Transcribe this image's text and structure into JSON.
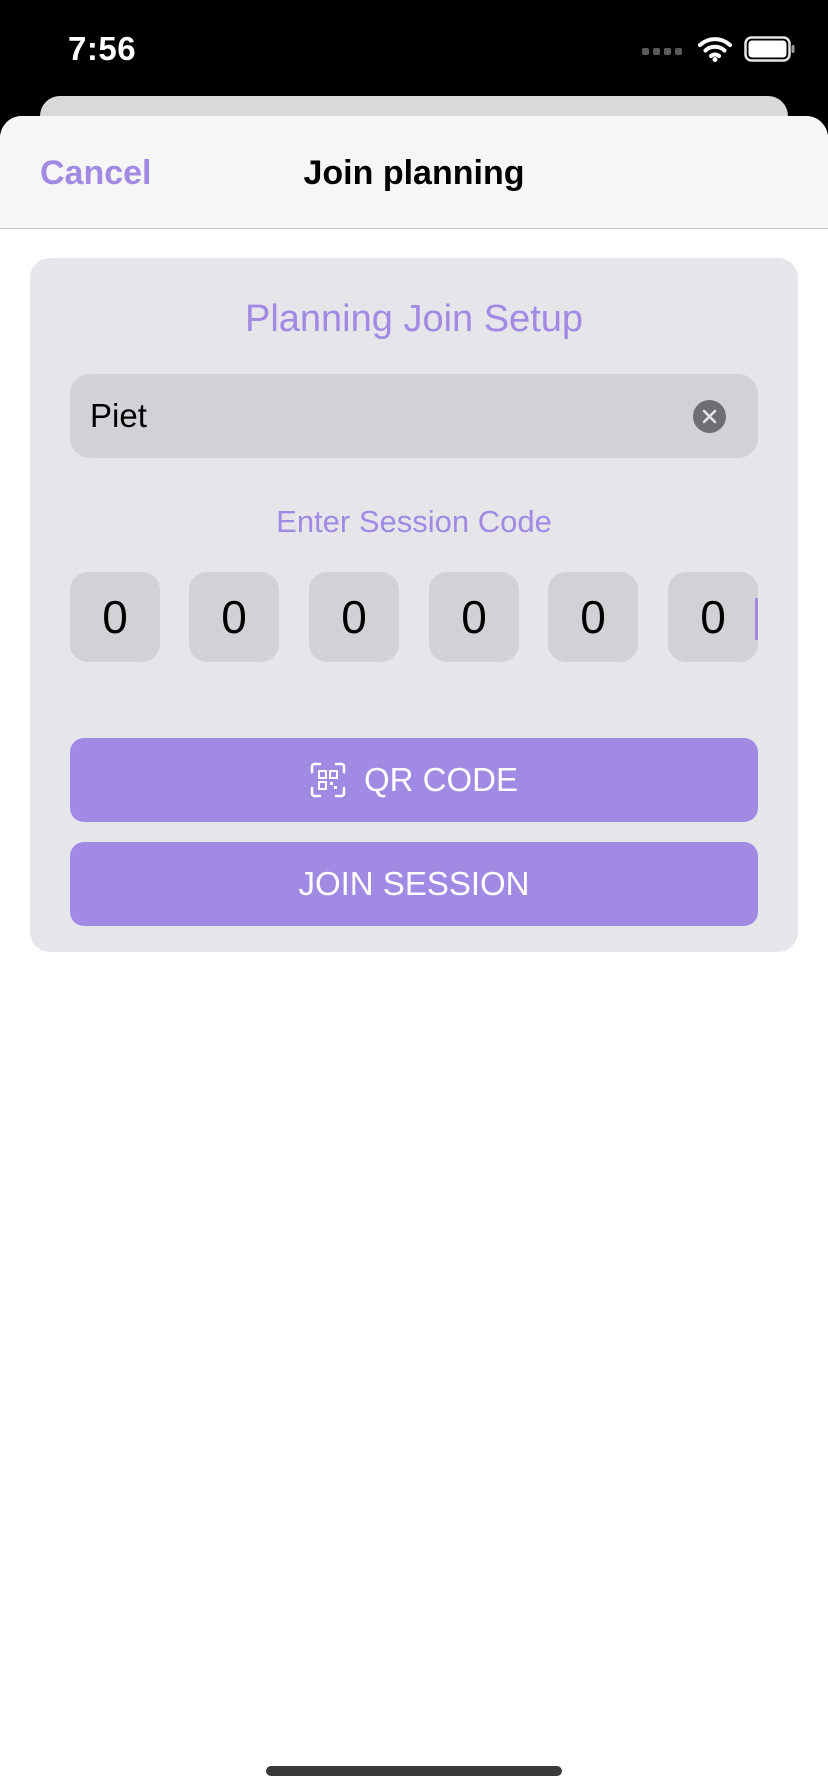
{
  "status_bar": {
    "time": "7:56",
    "icons": [
      "cellular-signal-icon",
      "wifi-icon",
      "battery-icon"
    ]
  },
  "nav": {
    "cancel_label": "Cancel",
    "title": "Join planning"
  },
  "form": {
    "title": "Planning Join Setup",
    "name_value": "Piet",
    "code_label": "Enter Session Code",
    "code_digits": [
      "0",
      "0",
      "0",
      "0",
      "0",
      "0"
    ],
    "qr_button_label": "QR CODE",
    "join_button_label": "JOIN SESSION"
  },
  "colors": {
    "accent": "#a08ae4",
    "card_background": "#e5e5ea",
    "field_background": "#d1d1d6",
    "nav_background": "#f6f6f6"
  }
}
